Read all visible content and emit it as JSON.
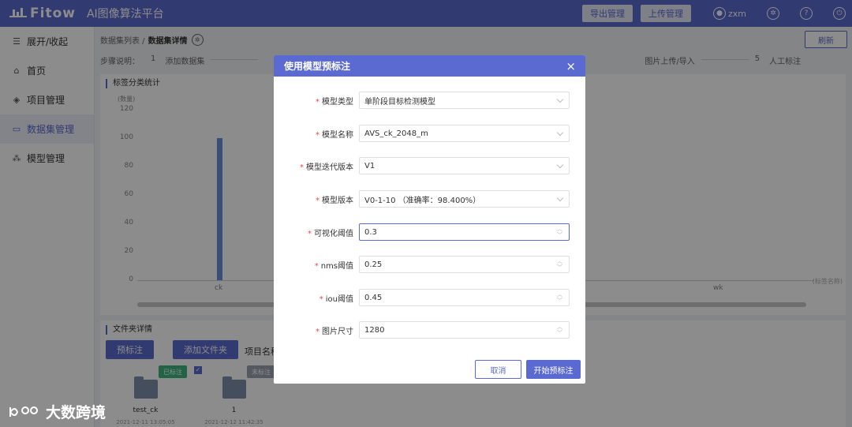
{
  "header": {
    "logo_text": "Fitow",
    "app_title": "AI图像算法平台",
    "export_btn": "导出管理",
    "upload_btn": "上传管理",
    "username": "zxm"
  },
  "sidebar": {
    "items": [
      {
        "label": "展开/收起",
        "icon": "collapse-icon"
      },
      {
        "label": "首页",
        "icon": "home-icon"
      },
      {
        "label": "项目管理",
        "icon": "layers-icon"
      },
      {
        "label": "数据集管理",
        "icon": "folder-icon",
        "active": true
      },
      {
        "label": "模型管理",
        "icon": "model-tree-icon"
      }
    ]
  },
  "breadcrumb": {
    "parent": "数据集列表 /",
    "current": "数据集详情"
  },
  "refresh_btn": "刷新",
  "steps": {
    "prefix": "步骤说明：",
    "step1_num": "1",
    "step1": "添加数据集",
    "step4": "图片上传/导入",
    "step5_num": "5",
    "step5": "人工标注"
  },
  "chart_panel": {
    "title": "标签分类统计",
    "y_unit": "(数量)",
    "x_axis_label": "(标签名称)"
  },
  "chart_data": {
    "type": "bar",
    "categories": [
      "ck",
      "wk"
    ],
    "values": [
      100,
      0
    ],
    "ylim": [
      0,
      120
    ],
    "yticks": [
      "120",
      "100",
      "80",
      "60",
      "40",
      "20",
      "0"
    ],
    "ylabel": "(数量)",
    "xlabel": "(标签名称)"
  },
  "files_panel": {
    "title": "文件夹详情",
    "pre_label_btn": "预标注",
    "add_folder_btn": "添加文件夹",
    "project_name_label": "项目名称",
    "cards": [
      {
        "badge": "已标注",
        "name": "test_ck",
        "time": "2021-12-11 13:05:05"
      },
      {
        "badge": "未标注",
        "name": "1",
        "time": "2021-12-12 11:42:35"
      }
    ]
  },
  "modal": {
    "title": "使用模型预标注",
    "close": "×",
    "fields": [
      {
        "label": "模型类型",
        "value": "单阶段目标检测模型",
        "kind": "select"
      },
      {
        "label": "模型名称",
        "value": "AVS_ck_2048_m",
        "kind": "select"
      },
      {
        "label": "模型迭代版本",
        "value": "V1",
        "kind": "select"
      },
      {
        "label": "模型版本",
        "value": "V0-1-10 （准确率：98.400%）",
        "kind": "select"
      },
      {
        "label": "可视化阈值",
        "value": "0.3",
        "kind": "number"
      },
      {
        "label": "nms阈值",
        "value": "0.25",
        "kind": "number"
      },
      {
        "label": "iou阈值",
        "value": "0.45",
        "kind": "number"
      },
      {
        "label": "图片尺寸",
        "value": "1280",
        "kind": "number"
      }
    ],
    "cancel_btn": "取消",
    "start_btn": "开始预标注"
  },
  "watermark": {
    "text": "大数跨境"
  },
  "colors": {
    "primary": "#5b6ad0",
    "bar": "#6a8fdc",
    "labeled_badge": "#3fb27f",
    "unlabeled_badge": "#9aa1b0",
    "required": "#e64a4a"
  }
}
